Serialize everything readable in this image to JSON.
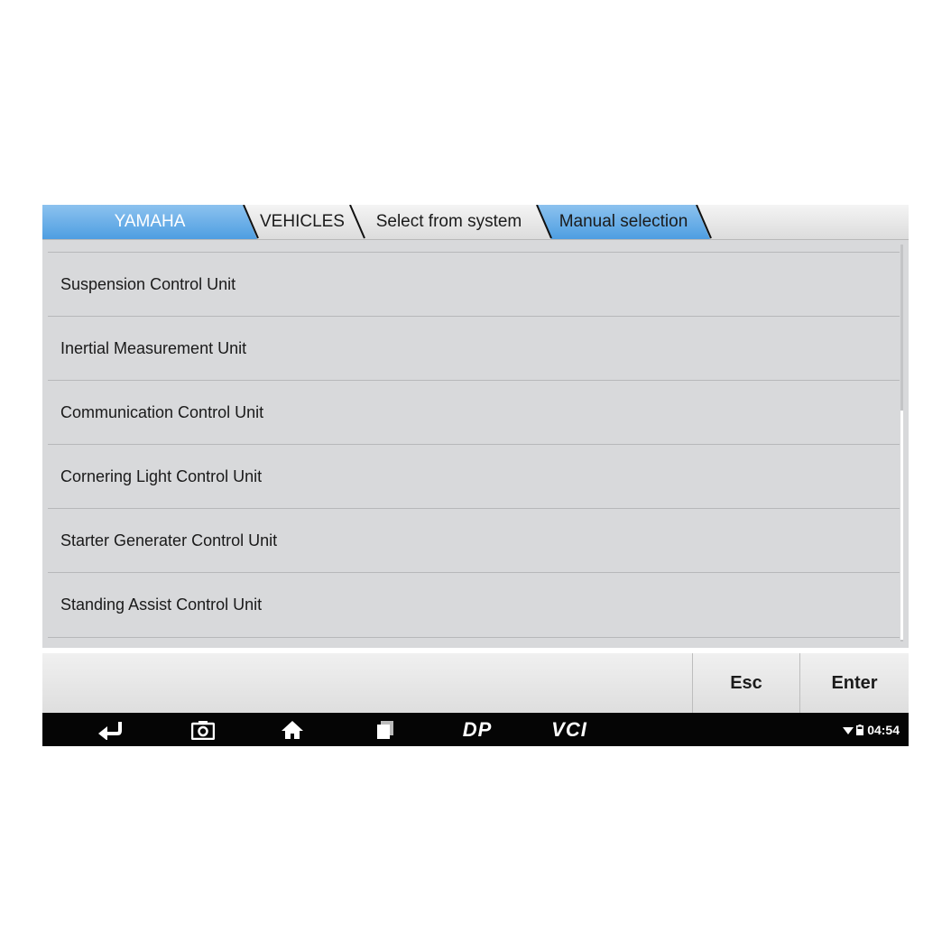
{
  "breadcrumb": {
    "items": [
      {
        "label": "YAMAHA"
      },
      {
        "label": "VEHICLES"
      },
      {
        "label": "Select from system"
      },
      {
        "label": "Manual selection"
      }
    ]
  },
  "list": {
    "items": [
      {
        "label": "Suspension Control Unit"
      },
      {
        "label": "Inertial Measurement Unit"
      },
      {
        "label": "Communication Control Unit"
      },
      {
        "label": "Cornering Light Control Unit"
      },
      {
        "label": "Starter Generater Control Unit"
      },
      {
        "label": "Standing Assist Control Unit"
      }
    ]
  },
  "toolbar": {
    "esc_label": "Esc",
    "enter_label": "Enter"
  },
  "navbar": {
    "icons": [
      "back-icon",
      "camera-icon",
      "home-icon",
      "recent-apps-icon",
      "dp-icon",
      "vci-icon"
    ],
    "dp_label": "DP",
    "vci_label": "VCI"
  },
  "status": {
    "time": "04:54"
  },
  "colors": {
    "accent_blue": "#4e9ee1",
    "list_bg": "#d8d9db",
    "navbar_bg": "#050505"
  }
}
